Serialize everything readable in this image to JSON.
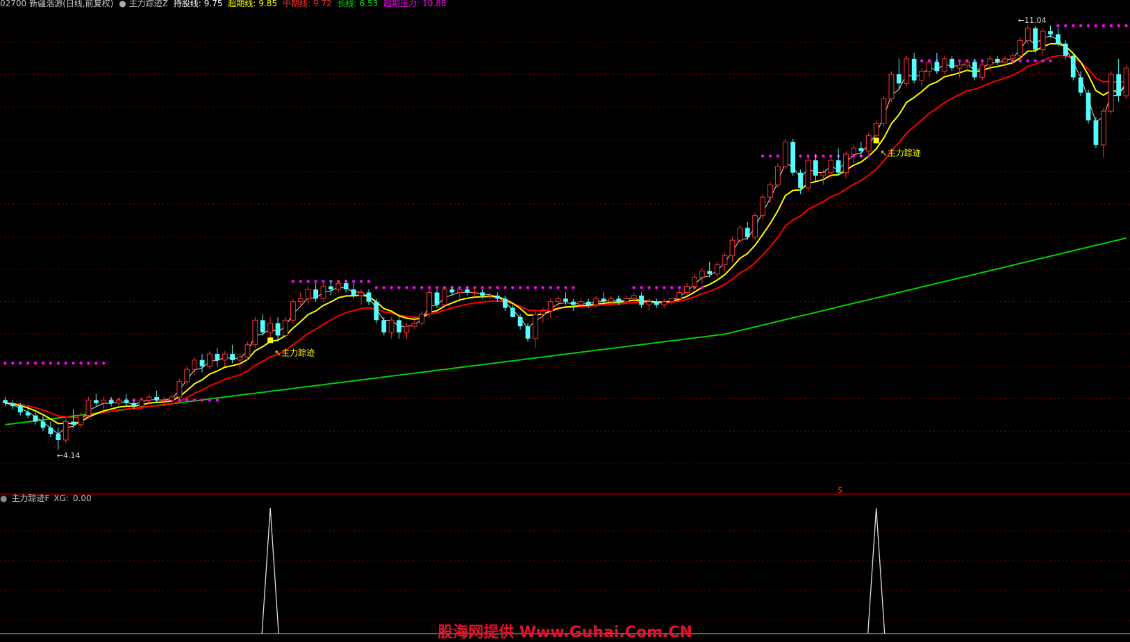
{
  "header": {
    "stock_code": "02700",
    "stock_name": "新疆浩源(日线,前复权)",
    "indicator_name": "主力踪迹Z",
    "hold_label": "持股线:",
    "hold_value": "9.75",
    "ultra_label": "超期线:",
    "ultra_value": "9.85",
    "mid_label": "中期线:",
    "mid_value": "9.72",
    "long_label": "长线:",
    "long_value": "6.53",
    "pressure_label": "超期压力:",
    "pressure_value": "10.88"
  },
  "sub_panel": {
    "indicator": "主力踪迹F",
    "xg_label": "XG:",
    "xg_value": "0.00"
  },
  "annotations": {
    "high_label": "11.04",
    "low_label": "4.14",
    "signal_label_1": "主力踪迹",
    "signal_label_2": "主力踪迹",
    "s_marker": "S"
  },
  "watermark": "股海网提供 Www.Guhai.Com.CN",
  "colors": {
    "background": "#000000",
    "up": "#ff3232",
    "down": "#54ffff",
    "yellow": "#ffff00",
    "red": "#ff0000",
    "green": "#00d000",
    "white": "#dddddd",
    "magenta": "#ff00ff",
    "grid": "#8b0000"
  },
  "chart_data": {
    "type": "candlestick",
    "price_range": [
      3.6,
      11.3
    ],
    "bars": [
      [
        4.95,
        5.0,
        4.85,
        4.9
      ],
      [
        4.9,
        4.95,
        4.8,
        4.85
      ],
      [
        4.85,
        4.9,
        4.7,
        4.75
      ],
      [
        4.75,
        4.85,
        4.65,
        4.7
      ],
      [
        4.7,
        4.75,
        4.55,
        4.6
      ],
      [
        4.6,
        4.7,
        4.45,
        4.5
      ],
      [
        4.5,
        4.6,
        4.35,
        4.4
      ],
      [
        4.4,
        4.5,
        4.14,
        4.3
      ],
      [
        4.3,
        4.65,
        4.25,
        4.6
      ],
      [
        4.6,
        4.8,
        4.5,
        4.55
      ],
      [
        4.55,
        4.75,
        4.5,
        4.7
      ],
      [
        4.7,
        5.0,
        4.65,
        4.95
      ],
      [
        4.95,
        5.05,
        4.85,
        4.9
      ],
      [
        4.9,
        5.0,
        4.8,
        4.95
      ],
      [
        4.95,
        5.0,
        4.85,
        4.9
      ],
      [
        4.9,
        5.0,
        4.85,
        4.95
      ],
      [
        4.95,
        5.05,
        4.85,
        4.9
      ],
      [
        4.9,
        4.95,
        4.8,
        4.85
      ],
      [
        4.85,
        5.0,
        4.8,
        4.95
      ],
      [
        4.95,
        5.05,
        4.9,
        5.0
      ],
      [
        5.0,
        5.1,
        4.9,
        4.95
      ],
      [
        4.95,
        5.0,
        4.85,
        4.95
      ],
      [
        4.95,
        5.05,
        4.9,
        5.0
      ],
      [
        5.0,
        5.3,
        4.95,
        5.25
      ],
      [
        5.25,
        5.5,
        5.2,
        5.45
      ],
      [
        5.45,
        5.65,
        5.35,
        5.6
      ],
      [
        5.6,
        5.7,
        5.4,
        5.5
      ],
      [
        5.5,
        5.75,
        5.45,
        5.7
      ],
      [
        5.7,
        5.8,
        5.5,
        5.6
      ],
      [
        5.6,
        5.75,
        5.5,
        5.7
      ],
      [
        5.7,
        5.85,
        5.55,
        5.6
      ],
      [
        5.6,
        5.7,
        5.45,
        5.65
      ],
      [
        5.65,
        5.9,
        5.6,
        5.85
      ],
      [
        5.85,
        6.3,
        5.8,
        6.25
      ],
      [
        6.25,
        6.35,
        6.0,
        6.05
      ],
      [
        6.05,
        6.3,
        5.9,
        6.2
      ],
      [
        6.2,
        6.3,
        5.9,
        6.0
      ],
      [
        6.0,
        6.3,
        5.95,
        6.25
      ],
      [
        6.25,
        6.6,
        6.2,
        6.55
      ],
      [
        6.55,
        6.7,
        6.45,
        6.6
      ],
      [
        6.6,
        6.8,
        6.5,
        6.75
      ],
      [
        6.75,
        6.85,
        6.55,
        6.6
      ],
      [
        6.6,
        6.85,
        6.55,
        6.8
      ],
      [
        6.8,
        6.9,
        6.65,
        6.75
      ],
      [
        6.75,
        6.9,
        6.7,
        6.85
      ],
      [
        6.85,
        6.9,
        6.7,
        6.75
      ],
      [
        6.75,
        6.85,
        6.6,
        6.65
      ],
      [
        6.65,
        6.75,
        6.5,
        6.7
      ],
      [
        6.7,
        6.75,
        6.5,
        6.55
      ],
      [
        6.55,
        6.6,
        6.2,
        6.25
      ],
      [
        6.25,
        6.3,
        6.0,
        6.05
      ],
      [
        6.05,
        6.3,
        5.95,
        6.25
      ],
      [
        6.25,
        6.3,
        5.95,
        6.05
      ],
      [
        6.05,
        6.2,
        5.95,
        6.15
      ],
      [
        6.15,
        6.3,
        6.1,
        6.2
      ],
      [
        6.2,
        6.4,
        6.15,
        6.35
      ],
      [
        6.35,
        6.75,
        6.3,
        6.7
      ],
      [
        6.7,
        6.75,
        6.45,
        6.5
      ],
      [
        6.5,
        6.8,
        6.45,
        6.75
      ],
      [
        6.75,
        6.8,
        6.65,
        6.7
      ],
      [
        6.7,
        6.8,
        6.6,
        6.75
      ],
      [
        6.75,
        6.8,
        6.65,
        6.7
      ],
      [
        6.7,
        6.8,
        6.6,
        6.7
      ],
      [
        6.7,
        6.75,
        6.6,
        6.65
      ],
      [
        6.65,
        6.7,
        6.6,
        6.65
      ],
      [
        6.65,
        6.7,
        6.55,
        6.6
      ],
      [
        6.6,
        6.65,
        6.4,
        6.45
      ],
      [
        6.45,
        6.5,
        6.3,
        6.3
      ],
      [
        6.3,
        6.35,
        6.1,
        6.15
      ],
      [
        6.15,
        6.2,
        5.9,
        5.95
      ],
      [
        5.95,
        6.4,
        5.8,
        6.35
      ],
      [
        6.35,
        6.45,
        6.2,
        6.4
      ],
      [
        6.4,
        6.6,
        6.3,
        6.55
      ],
      [
        6.55,
        6.65,
        6.4,
        6.6
      ],
      [
        6.6,
        6.7,
        6.5,
        6.55
      ],
      [
        6.55,
        6.6,
        6.4,
        6.5
      ],
      [
        6.5,
        6.6,
        6.45,
        6.55
      ],
      [
        6.55,
        6.6,
        6.45,
        6.5
      ],
      [
        6.5,
        6.65,
        6.45,
        6.6
      ],
      [
        6.6,
        6.7,
        6.5,
        6.55
      ],
      [
        6.55,
        6.65,
        6.5,
        6.6
      ],
      [
        6.6,
        6.65,
        6.5,
        6.55
      ],
      [
        6.55,
        6.65,
        6.5,
        6.6
      ],
      [
        6.6,
        6.7,
        6.55,
        6.65
      ],
      [
        6.65,
        6.7,
        6.45,
        6.5
      ],
      [
        6.5,
        6.6,
        6.4,
        6.55
      ],
      [
        6.55,
        6.6,
        6.45,
        6.5
      ],
      [
        6.5,
        6.6,
        6.45,
        6.55
      ],
      [
        6.55,
        6.6,
        6.5,
        6.6
      ],
      [
        6.6,
        6.75,
        6.55,
        6.7
      ],
      [
        6.7,
        6.85,
        6.65,
        6.8
      ],
      [
        6.8,
        7.0,
        6.75,
        6.95
      ],
      [
        6.95,
        7.1,
        6.85,
        7.05
      ],
      [
        7.05,
        7.2,
        6.95,
        7.0
      ],
      [
        7.0,
        7.2,
        6.95,
        7.15
      ],
      [
        7.15,
        7.35,
        7.05,
        7.3
      ],
      [
        7.3,
        7.6,
        7.2,
        7.55
      ],
      [
        7.55,
        7.8,
        7.5,
        7.75
      ],
      [
        7.75,
        7.85,
        7.55,
        7.6
      ],
      [
        7.6,
        8.0,
        7.55,
        7.95
      ],
      [
        7.95,
        8.3,
        7.9,
        8.25
      ],
      [
        8.25,
        8.5,
        8.15,
        8.45
      ],
      [
        8.45,
        8.8,
        8.4,
        8.75
      ],
      [
        8.75,
        9.2,
        8.7,
        9.15
      ],
      [
        9.15,
        9.2,
        8.6,
        8.65
      ],
      [
        8.65,
        8.7,
        8.3,
        8.4
      ],
      [
        8.4,
        8.9,
        8.35,
        8.85
      ],
      [
        8.85,
        8.95,
        8.5,
        8.6
      ],
      [
        8.6,
        8.7,
        8.45,
        8.65
      ],
      [
        8.65,
        8.9,
        8.55,
        8.85
      ],
      [
        8.85,
        9.05,
        8.6,
        8.65
      ],
      [
        8.65,
        9.0,
        8.55,
        8.95
      ],
      [
        8.95,
        9.1,
        8.8,
        9.05
      ],
      [
        9.05,
        9.15,
        8.9,
        9.0
      ],
      [
        9.0,
        9.3,
        8.95,
        9.25
      ],
      [
        9.25,
        9.5,
        9.15,
        9.45
      ],
      [
        9.45,
        9.9,
        9.4,
        9.85
      ],
      [
        9.85,
        10.3,
        9.8,
        10.25
      ],
      [
        10.25,
        10.5,
        10.0,
        10.1
      ],
      [
        10.1,
        10.55,
        10.05,
        10.5
      ],
      [
        10.5,
        10.6,
        10.1,
        10.15
      ],
      [
        10.15,
        10.35,
        10.05,
        10.3
      ],
      [
        10.3,
        10.5,
        10.2,
        10.45
      ],
      [
        10.45,
        10.6,
        10.25,
        10.3
      ],
      [
        10.3,
        10.55,
        10.25,
        10.5
      ],
      [
        10.5,
        10.55,
        10.3,
        10.35
      ],
      [
        10.35,
        10.45,
        10.2,
        10.4
      ],
      [
        10.4,
        10.5,
        10.3,
        10.45
      ],
      [
        10.45,
        10.5,
        10.15,
        10.2
      ],
      [
        10.2,
        10.45,
        10.15,
        10.4
      ],
      [
        10.4,
        10.55,
        10.3,
        10.5
      ],
      [
        10.5,
        10.55,
        10.4,
        10.45
      ],
      [
        10.45,
        10.55,
        10.35,
        10.5
      ],
      [
        10.5,
        10.6,
        10.4,
        10.55
      ],
      [
        10.55,
        10.85,
        10.5,
        10.8
      ],
      [
        10.8,
        11.04,
        10.75,
        11.0
      ],
      [
        11.0,
        11.04,
        10.6,
        10.65
      ],
      [
        10.65,
        11.0,
        10.55,
        10.95
      ],
      [
        10.95,
        11.04,
        10.85,
        10.9
      ],
      [
        10.9,
        11.0,
        10.7,
        10.75
      ],
      [
        10.75,
        10.8,
        10.5,
        10.55
      ],
      [
        10.55,
        10.6,
        10.15,
        10.2
      ],
      [
        10.2,
        10.3,
        9.9,
        9.95
      ],
      [
        9.95,
        10.0,
        9.45,
        9.5
      ],
      [
        9.5,
        9.55,
        9.05,
        9.1
      ],
      [
        9.1,
        9.7,
        8.9,
        9.65
      ],
      [
        9.65,
        10.3,
        9.6,
        10.25
      ],
      [
        10.25,
        10.5,
        9.8,
        9.9
      ],
      [
        9.9,
        10.4,
        9.85,
        10.35
      ]
    ],
    "signals": [
      35,
      115
    ],
    "xg_range": [
      0,
      1
    ]
  }
}
